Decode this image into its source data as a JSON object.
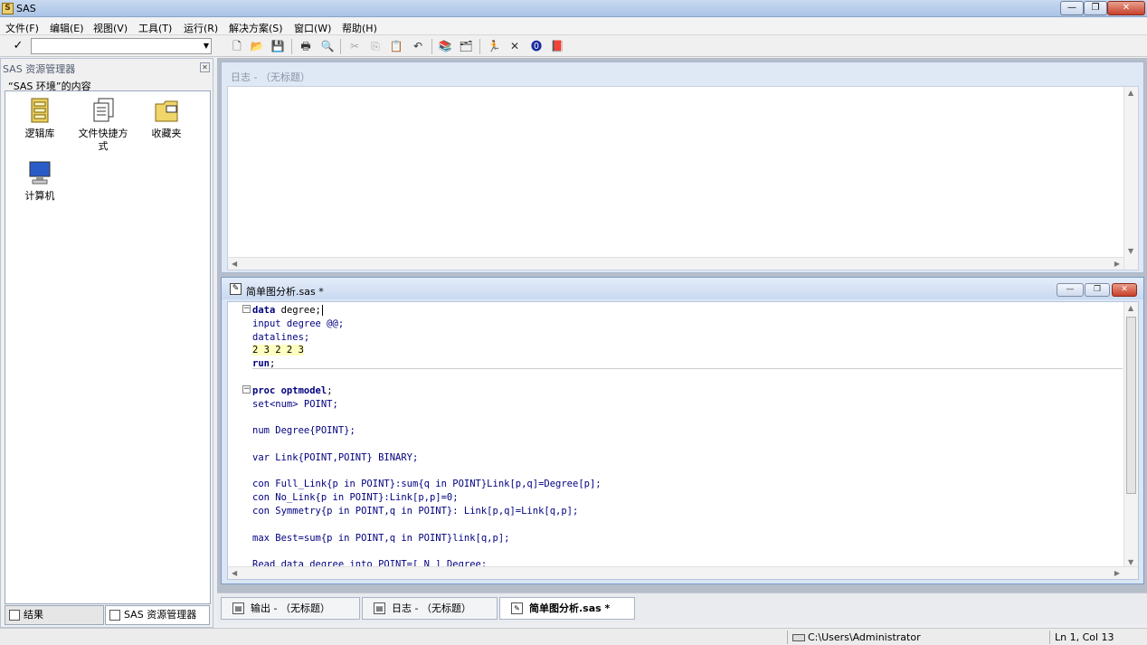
{
  "window": {
    "title": "SAS",
    "icon_label": "SAS",
    "buttons": {
      "minimize": "—",
      "maximize": "❐",
      "close": "✕"
    }
  },
  "menu": [
    "文件(F)",
    "编辑(E)",
    "视图(V)",
    "工具(T)",
    "运行(R)",
    "解决方案(S)",
    "窗口(W)",
    "帮助(H)"
  ],
  "toolbar": {
    "command_value": "",
    "icons": [
      "new-icon",
      "open-icon",
      "save-icon",
      "print-icon",
      "print-preview-icon",
      "cut-icon",
      "copy-icon",
      "paste-icon",
      "undo-icon",
      "libraries-icon",
      "explorer-icon",
      "submit-icon",
      "clear-icon",
      "help-icon",
      "book-icon"
    ]
  },
  "explorer": {
    "title": "SAS 资源管理器",
    "subtitle": "“SAS 环境”的内容",
    "items": [
      {
        "label": "逻辑库",
        "icon": "library-icon"
      },
      {
        "label": "文件快捷方式",
        "icon": "file-shortcut-icon"
      },
      {
        "label": "收藏夹",
        "icon": "favorites-folder-icon"
      },
      {
        "label": "计算机",
        "icon": "computer-icon"
      }
    ],
    "tabs": {
      "results": "结果",
      "explorer": "SAS 资源管理器"
    }
  },
  "log": {
    "title": "日志 - （无标题）"
  },
  "editor": {
    "title": "简单图分析.sas *",
    "code": [
      "data degree;",
      "input degree @@;",
      "datalines;",
      "2 3 2 2 3",
      "run;",
      "",
      "proc optmodel;",
      "set<num> POINT;",
      "",
      "num Degree{POINT};",
      "",
      "var Link{POINT,POINT} BINARY;",
      "",
      "con Full_Link{p in POINT}:sum{q in POINT}Link[p,q]=Degree[p];",
      "con No_Link{p in POINT}:Link[p,p]=0;",
      "con Symmetry{p in POINT,q in POINT}: Link[p,q]=Link[q,p];",
      "",
      "max Best=sum{p in POINT,q in POINT}link[q,p];",
      "",
      "Read data degree into POINT=[_N_] Degree;"
    ]
  },
  "window_tabs": [
    "输出 - （无标题）",
    "日志 - （无标题）",
    "简单图分析.sas *"
  ],
  "status": {
    "path": "C:\\Users\\Administrator",
    "position": "Ln 1, Col 13"
  }
}
